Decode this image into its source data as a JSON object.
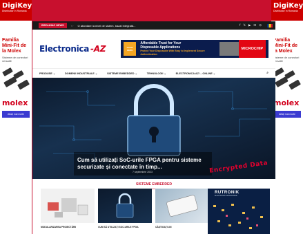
{
  "side_ad": {
    "brand": "DigiKey",
    "tagline": "Distribuitor în Romania",
    "headline": "Familia Mini-Fit de la Molex",
    "sub": "Sisteme de conectori versatili",
    "molex": "molex",
    "button": "Aflați mai multe"
  },
  "topbar": {
    "badge": "BREAKING NEWS",
    "arrows": "‹ ›",
    "headline": "O abordare la nivel de sistem, bazat integrată...",
    "social_icons": [
      "facebook-icon",
      "twitter-icon",
      "youtube-icon",
      "email-icon",
      "rss-icon"
    ],
    "social_glyphs": [
      "f",
      "𝕏",
      "▶",
      "✉",
      "⊙"
    ]
  },
  "header": {
    "logo_main": "Electronica",
    "logo_accent": "-AZ",
    "banner": {
      "badge": "CLICK HERE",
      "title_line1": "Affordable Trust for Your",
      "title_line2": "Disposable Applications",
      "sub": "Protect Your Disposable With Easy to Implement Secure Authentication",
      "brand": "MICROCHIP"
    }
  },
  "nav": {
    "items": [
      "PRODUSE ⌄",
      "DOMENII INDUSTRIALE ⌄",
      "SISTEME EMBEDDED ⌄",
      "TEHNOLOGII ⌄",
      "ELECTRONICA AZ! – ONLINE ⌄"
    ],
    "search_glyph": "⌕"
  },
  "hero": {
    "title": "Cum să utilizați SoC-urile FPGA pentru sisteme securizate și conectate în timp...",
    "date": "7 septembrie 2023",
    "overlay_text": "Encrypted Data"
  },
  "section": {
    "title": "SISTEME EMBEDDED",
    "cards": [
      {
        "title": "MODULARIZAREA PROIECTĂRII"
      },
      {
        "title": "CUM SĂ UTILIZAȚI SOC-URILE FPGA"
      },
      {
        "title": "CÂȘTIGAȚI UN"
      }
    ],
    "ad": {
      "brand": "RUTRONIK",
      "sub": "ELECTRONIC WORLDWIDE"
    }
  },
  "colors": {
    "accent": "#c8102e",
    "navy": "#0a2a8a"
  }
}
